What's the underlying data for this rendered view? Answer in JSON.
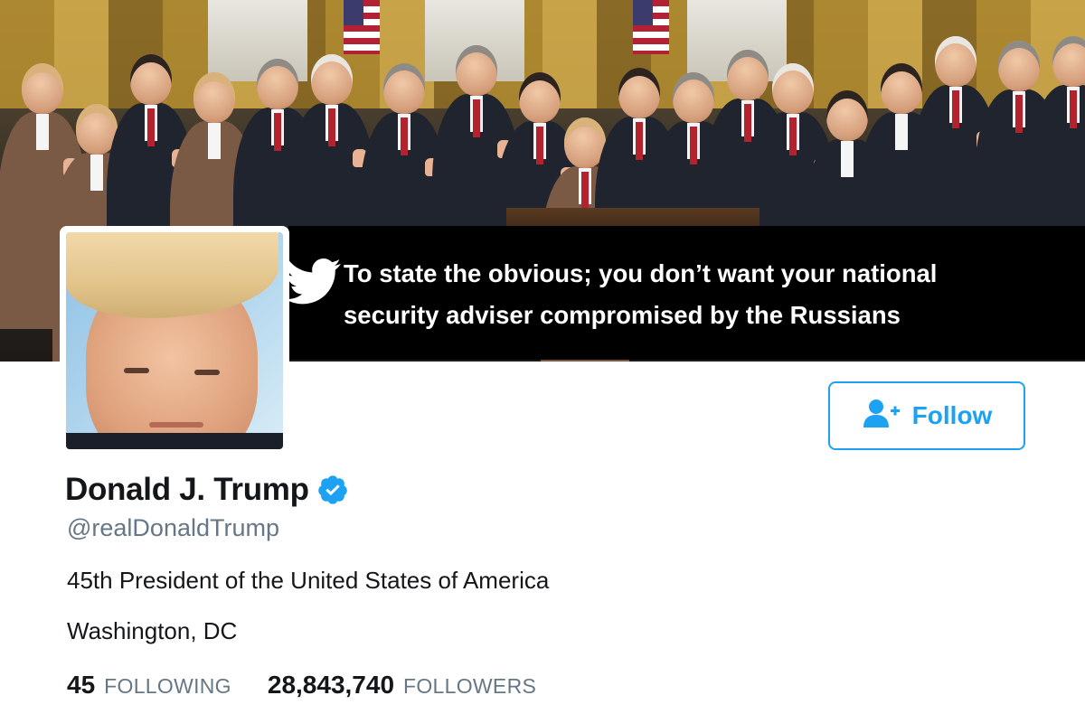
{
  "header": {
    "banner_lines": [
      "To state the obvious; you don’t want your national",
      "security adviser compromised by the Russians"
    ]
  },
  "profile": {
    "name": "Donald J. Trump",
    "verified": true,
    "screen_name": "@realDonaldTrump",
    "bio": "45th President of the United States of America",
    "location": "Washington, DC"
  },
  "actions": {
    "follow_label": "Follow"
  },
  "stats": {
    "following_count": "45",
    "following_label": "FOLLOWING",
    "followers_count": "28,843,740",
    "followers_label": "FOLLOWERS"
  },
  "colors": {
    "accent": "#1da1f2",
    "text_primary": "#14171a",
    "text_secondary": "#657786",
    "banner_bg": "#000000"
  },
  "icons": {
    "follow": "add-user-icon",
    "verified": "verified-badge-icon",
    "banner": "twitter-bird-icon"
  }
}
